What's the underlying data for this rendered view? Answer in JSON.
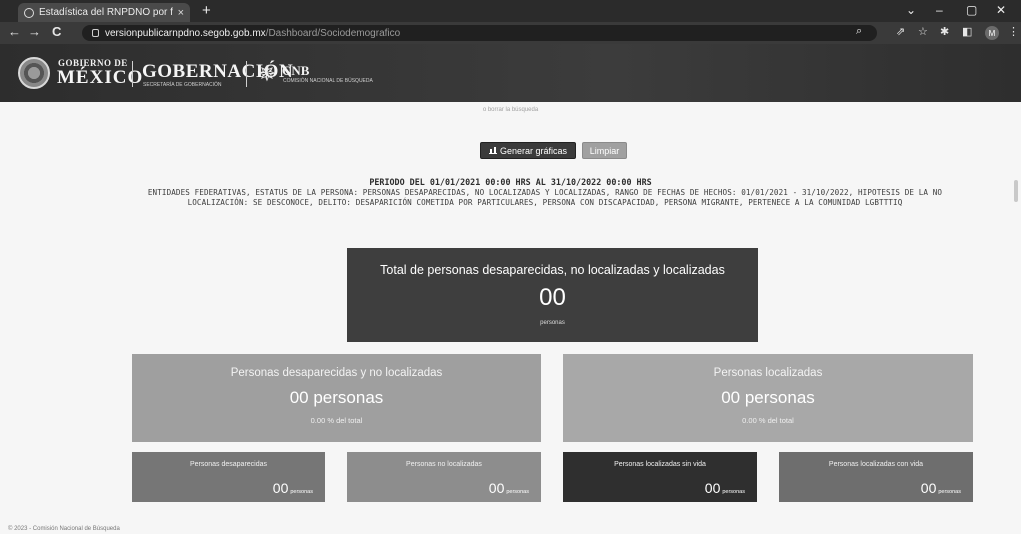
{
  "browser": {
    "tab_title": "Estadística del RNPDNO por filtr",
    "tab_close": "×",
    "new_tab": "+",
    "url_host": "versionpublicarnpdno.segob.gob.mx",
    "url_path": "/Dashboard/Sociodemografico",
    "profile_initial": "M",
    "window_controls": {
      "minimize": "–",
      "maximize": "▢",
      "close": "✕",
      "tabs_menu": "⌄"
    },
    "nav": {
      "back": "←",
      "forward": "→",
      "reload": "C"
    },
    "toolbar_icons": {
      "search": "⌕",
      "share": "⇗",
      "star": "☆",
      "extensions": "✱",
      "sidepanel": "◧",
      "menu": "⋮"
    }
  },
  "header": {
    "gobierno_de": "GOBIERNO DE",
    "mexico": "MÉXICO",
    "gobernacion": "GOBERNACIÓN",
    "gobernacion_sub": "SECRETARÍA DE GOBERNACIÓN",
    "cnb": "CNB",
    "cnb_sub": "COMISIÓN NACIONAL DE BÚSQUEDA"
  },
  "main": {
    "hint": "o borrar la búsqueda",
    "generate_button": "Generar gráficas",
    "clear_button": "Limpiar",
    "periodo": "PERIODO DEL 01/01/2021 00:00 HRS AL 31/10/2022 00:00 HRS",
    "filtros": "ENTIDADES FEDERATIVAS, ESTATUS DE LA PERSONA: PERSONAS DESAPARECIDAS, NO LOCALIZADAS Y LOCALIZADAS, RANGO DE FECHAS DE HECHOS: 01/01/2021 - 31/10/2022, HIPOTESIS DE LA NO LOCALIZACIÓN: SE DESCONOCE, DELITO: DESAPARICIÓN COMETIDA POR PARTICULARES, PERSONA CON DISCAPACIDAD, PERSONA MIGRANTE, PERTENECE A LA COMUNIDAD LGBTTTIQ"
  },
  "totals": {
    "title": "Total de personas desaparecidas, no localizadas y localizadas",
    "value": "00",
    "unit": "personas"
  },
  "summary": [
    {
      "title": "Personas desaparecidas y no localizadas",
      "value": "00 personas",
      "pct": "0.00 % del total"
    },
    {
      "title": "Personas localizadas",
      "value": "00 personas",
      "pct": "0.00 % del total"
    }
  ],
  "breakdown": [
    {
      "title": "Personas desaparecidas",
      "value": "00",
      "unit": "personas"
    },
    {
      "title": "Personas no localizadas",
      "value": "00",
      "unit": "personas"
    },
    {
      "title": "Personas localizadas sin vida",
      "value": "00",
      "unit": "personas"
    },
    {
      "title": "Personas localizadas con vida",
      "value": "00",
      "unit": "personas"
    }
  ],
  "footer": "© 2023 - Comisión Nacional de Búsqueda"
}
